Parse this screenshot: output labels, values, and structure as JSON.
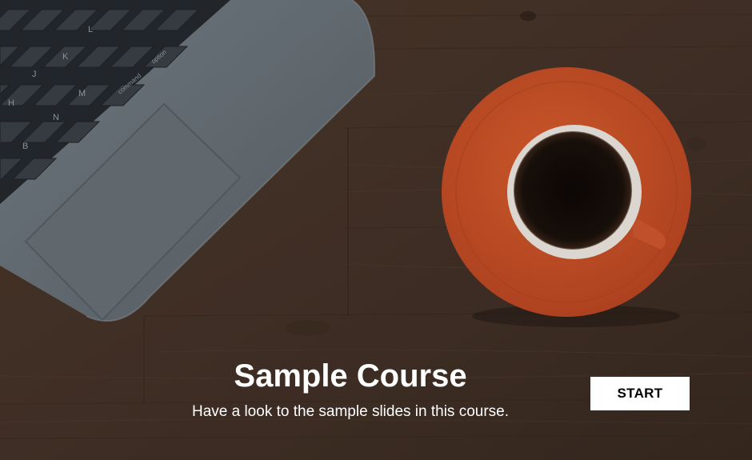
{
  "course": {
    "title": "Sample Course",
    "subtitle": "Have a look to the sample slides in this course.",
    "start_label": "START"
  },
  "keyboard": {
    "key_labels": [
      "B",
      "N",
      "M",
      "K",
      "L",
      "J",
      "H",
      "option",
      "command"
    ]
  },
  "colors": {
    "wood": "#4a3628",
    "laptop": "#6e767d",
    "saucer": "#d5552d",
    "button_bg": "#ffffff",
    "text": "#ffffff"
  }
}
